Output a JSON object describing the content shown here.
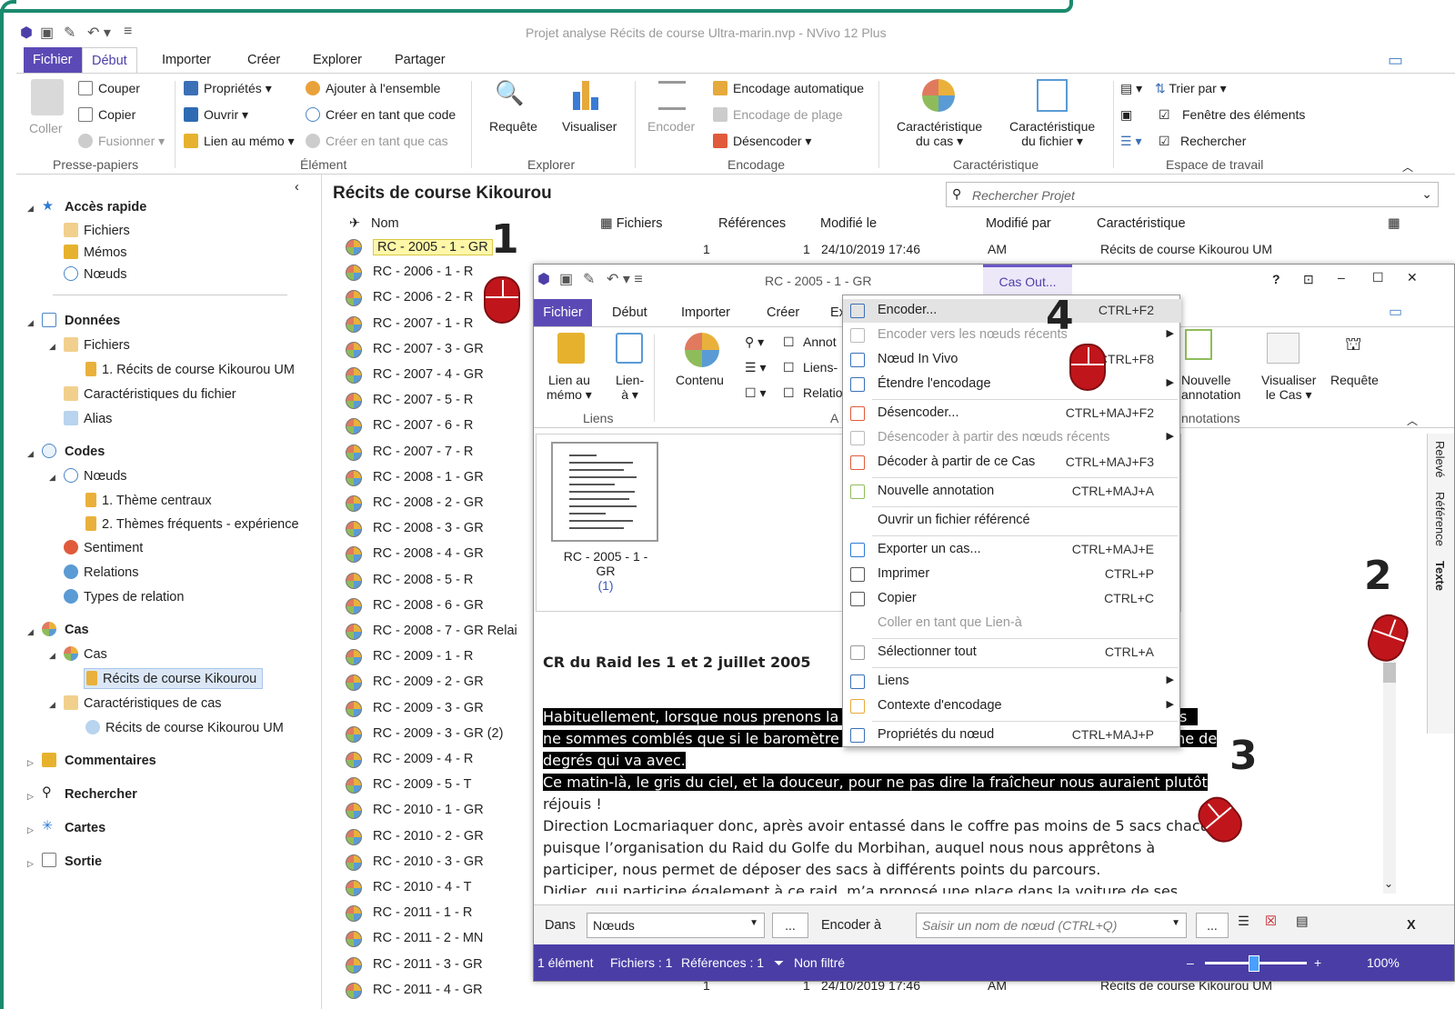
{
  "app": {
    "title": "Projet analyse Récits de course Ultra-marin.nvp - NVivo 12 Plus"
  },
  "ribbon": {
    "tabs": [
      "Fichier",
      "Début",
      "Importer",
      "Créer",
      "Explorer",
      "Partager"
    ],
    "presse_papiers": {
      "coller": "Coller",
      "couper": "Couper",
      "copier": "Copier",
      "fusionner": "Fusionner",
      "group": "Presse-papiers"
    },
    "element": {
      "proprietes": "Propriétés",
      "ouvrir": "Ouvrir",
      "lien_memo": "Lien au mémo",
      "ajouter": "Ajouter à l'ensemble",
      "creer_code": "Créer en tant que code",
      "creer_cas": "Créer en tant que cas",
      "group": "Élément"
    },
    "explorer": {
      "requete": "Requête",
      "visualiser": "Visualiser",
      "group": "Explorer"
    },
    "encodage": {
      "encoder": "Encoder",
      "auto": "Encodage automatique",
      "plage": "Encodage de plage",
      "desencoder": "Désencoder",
      "group": "Encodage"
    },
    "caracteristique": {
      "cas_l1": "Caractéristique",
      "cas_l2": "du cas",
      "fichier_l1": "Caractéristique",
      "fichier_l2": "du fichier",
      "group": "Caractéristique"
    },
    "espace": {
      "trier": "Trier par",
      "fenetre": "Fenêtre des éléments",
      "rechercher": "Rechercher",
      "group": "Espace de travail"
    }
  },
  "nav": {
    "acces_rapide": "Accès rapide",
    "fichiers": "Fichiers",
    "memos": "Mémos",
    "noeuds": "Nœuds",
    "donnees": "Données",
    "d_fichiers": "Fichiers",
    "recits": "1. Récits de course Kikourou UM",
    "caract_fichier": "Caractéristiques du fichier",
    "alias": "Alias",
    "codes": "Codes",
    "c_noeuds": "Nœuds",
    "theme1": "1. Thème centraux",
    "theme2": "2. Thèmes fréquents - expérience",
    "sentiment": "Sentiment",
    "relations": "Relations",
    "types_relation": "Types de relation",
    "cas": "Cas",
    "cas_sub": "Cas",
    "recits_kikourou": "Récits de course Kikourou",
    "caract_cas": "Caractéristiques de cas",
    "recits_um": "Récits de course Kikourou UM",
    "commentaires": "Commentaires",
    "rechercher": "Rechercher",
    "cartes": "Cartes",
    "sortie": "Sortie"
  },
  "list": {
    "title": "Récits de course Kikourou",
    "search_placeholder": "Rechercher Projet",
    "columns": {
      "nom": "Nom",
      "fichiers": "Fichiers",
      "references": "Références",
      "modifie_le": "Modifié le",
      "modifie_par": "Modifié par",
      "caracteristique": "Caractéristique"
    },
    "first_row": {
      "fichiers": "1",
      "references": "1",
      "modifie_le": "24/10/2019 17:46",
      "modifie_par": "AM",
      "caracteristique": "Récits de course Kikourou UM"
    },
    "last_row": {
      "fichiers": "1",
      "references": "1",
      "modifie_le": "24/10/2019 17:46",
      "modifie_par": "AM",
      "caracteristique": "Récits de course Kikourou UM"
    },
    "rows": [
      "RC - 2005 - 1 - GR",
      "RC - 2006 - 1 - R",
      "RC - 2006 - 2 - R",
      "RC - 2007 - 1 - R",
      "RC - 2007 - 3 - GR",
      "RC - 2007 - 4 - GR",
      "RC - 2007 - 5 - R",
      "RC - 2007 - 6 - R",
      "RC - 2007 - 7 - R",
      "RC - 2008 - 1 - GR",
      "RC - 2008 - 2 - GR",
      "RC - 2008 - 3 - GR",
      "RC - 2008 - 4 - GR",
      "RC - 2008 - 5 - R",
      "RC - 2008 - 6 - GR",
      "RC - 2008 - 7 - GR Relai",
      "RC - 2009 - 1 - R",
      "RC - 2009 - 2 - GR",
      "RC - 2009 - 3 - GR",
      "RC - 2009 - 3 - GR (2)",
      "RC - 2009 - 4 - R",
      "RC - 2009 - 5 - T",
      "RC - 2010 - 1 - GR",
      "RC - 2010 - 2 - GR",
      "RC - 2010 - 3 - GR",
      "RC - 2010 - 4 - T",
      "RC - 2011 - 1 - R",
      "RC - 2011 - 2 - MN",
      "RC - 2011 - 3 - GR",
      "RC - 2011 - 4 - GR"
    ]
  },
  "case_window": {
    "title": "RC - 2005 - 1 - GR",
    "cas_tab": "Cas Out...",
    "tabs": [
      "Fichier",
      "Début",
      "Importer",
      "Créer",
      "Ex"
    ],
    "liens": {
      "lien_memo_l1": "Lien au",
      "lien_memo_l2": "mémo",
      "lien_a_l1": "Lien-",
      "lien_a_l2": "à",
      "group": "Liens"
    },
    "contenu": "Contenu",
    "annot": "Annot",
    "liens_a": "Liens-",
    "relatio": "Relatio",
    "a_group": "A",
    "annotations": {
      "nouvelle_l1": "Nouvelle",
      "nouvelle_l2": "annotation",
      "group": "nnotations"
    },
    "visualiser_l1": "Visualiser",
    "visualiser_l2": "le Cas",
    "requete": "Requête",
    "thumb_label_l1": "RC - 2005 - 1 -",
    "thumb_label_l2": "GR",
    "thumb_count": "(1)",
    "side_tabs": [
      "Relevé",
      "Référence",
      "Texte"
    ],
    "doc": {
      "title": "CR du Raid les 1 et 2 juillet 2005",
      "l1": "Habituellement, lorsque nous prenons la",
      "l1_end": "s",
      "l2": "ne sommes comblés que si le baromètre est sur le « beau fixe », avec la bonne vingtaine de",
      "l3": "degrés qui va avec.",
      "l4": "Ce matin-là, le gris du ciel, et la douceur, pour ne pas dire la fraîcheur nous auraient plutôt",
      "l5": "réjouis !",
      "l6": "Direction Locmariaquer donc, après avoir entassé dans le coffre pas moins de 5 sacs chacun,",
      "l7": "puisque l’organisation du Raid du Golfe du Morbihan, auquel nous nous apprêtons à",
      "l8": "participer, nous permet de déposer des sacs à différents points du parcours.",
      "l9": "Didier, qui participe également à ce raid, m’a proposé une place dans la voiture de ses"
    },
    "codebar": {
      "dans": "Dans",
      "dans_value": "Nœuds",
      "dots": "...",
      "encoder_a": "Encoder à",
      "node_placeholder": "Saisir un nom de nœud (CTRL+Q)",
      "close": "X"
    },
    "status": {
      "elements": "1 élément",
      "fichiers": "Fichiers : 1",
      "references": "Références : 1",
      "filtre": "Non filtré",
      "zoom": "100%"
    }
  },
  "context_menu": {
    "items": [
      {
        "label": "Encoder...",
        "key": "CTRL+F2",
        "disabled": false
      },
      {
        "label": "Encoder vers les nœuds récents",
        "key": "",
        "disabled": true,
        "arrow": true
      },
      {
        "label": "Nœud In Vivo",
        "key": "CTRL+F8",
        "disabled": false
      },
      {
        "label": "Étendre l'encodage",
        "key": "",
        "disabled": false,
        "arrow": true
      },
      {
        "label": "Désencoder...",
        "key": "CTRL+MAJ+F2",
        "disabled": false
      },
      {
        "label": "Désencoder à partir des nœuds récents",
        "key": "",
        "disabled": true,
        "arrow": true
      },
      {
        "label": "Décoder à partir de ce Cas",
        "key": "CTRL+MAJ+F3",
        "disabled": false
      },
      {
        "label": "Nouvelle annotation",
        "key": "CTRL+MAJ+A",
        "disabled": false
      },
      {
        "label": "Ouvrir un fichier référencé",
        "key": "",
        "disabled": false
      },
      {
        "label": "Exporter un cas...",
        "key": "CTRL+MAJ+E",
        "disabled": false
      },
      {
        "label": "Imprimer",
        "key": "CTRL+P",
        "disabled": false
      },
      {
        "label": "Copier",
        "key": "CTRL+C",
        "disabled": false
      },
      {
        "label": "Coller en tant que Lien-à",
        "key": "",
        "disabled": true
      },
      {
        "label": "Sélectionner tout",
        "key": "CTRL+A",
        "disabled": false
      },
      {
        "label": "Liens",
        "key": "",
        "disabled": false,
        "arrow": true
      },
      {
        "label": "Contexte d'encodage",
        "key": "",
        "disabled": false,
        "arrow": true
      },
      {
        "label": "Propriétés du nœud",
        "key": "CTRL+MAJ+P",
        "disabled": false
      }
    ]
  },
  "annotations": {
    "n1": "1",
    "n2": "2",
    "n3": "3",
    "n4": "4"
  }
}
